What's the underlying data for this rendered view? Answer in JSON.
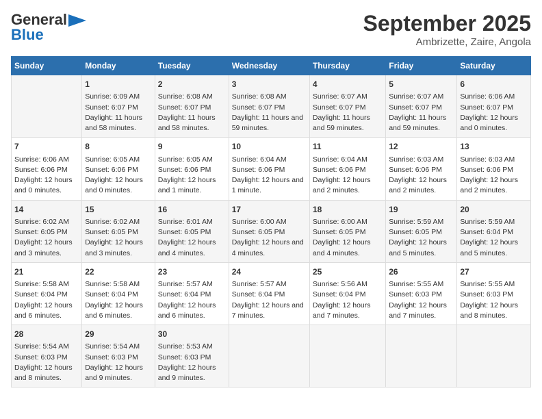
{
  "logo": {
    "general": "General",
    "blue": "Blue"
  },
  "title": "September 2025",
  "subtitle": "Ambrizette, Zaire, Angola",
  "days": [
    "Sunday",
    "Monday",
    "Tuesday",
    "Wednesday",
    "Thursday",
    "Friday",
    "Saturday"
  ],
  "weeks": [
    [
      {
        "day": "",
        "sunrise": "",
        "sunset": "",
        "daylight": ""
      },
      {
        "day": "1",
        "sunrise": "Sunrise: 6:09 AM",
        "sunset": "Sunset: 6:07 PM",
        "daylight": "Daylight: 11 hours and 58 minutes."
      },
      {
        "day": "2",
        "sunrise": "Sunrise: 6:08 AM",
        "sunset": "Sunset: 6:07 PM",
        "daylight": "Daylight: 11 hours and 58 minutes."
      },
      {
        "day": "3",
        "sunrise": "Sunrise: 6:08 AM",
        "sunset": "Sunset: 6:07 PM",
        "daylight": "Daylight: 11 hours and 59 minutes."
      },
      {
        "day": "4",
        "sunrise": "Sunrise: 6:07 AM",
        "sunset": "Sunset: 6:07 PM",
        "daylight": "Daylight: 11 hours and 59 minutes."
      },
      {
        "day": "5",
        "sunrise": "Sunrise: 6:07 AM",
        "sunset": "Sunset: 6:07 PM",
        "daylight": "Daylight: 11 hours and 59 minutes."
      },
      {
        "day": "6",
        "sunrise": "Sunrise: 6:06 AM",
        "sunset": "Sunset: 6:07 PM",
        "daylight": "Daylight: 12 hours and 0 minutes."
      }
    ],
    [
      {
        "day": "7",
        "sunrise": "Sunrise: 6:06 AM",
        "sunset": "Sunset: 6:06 PM",
        "daylight": "Daylight: 12 hours and 0 minutes."
      },
      {
        "day": "8",
        "sunrise": "Sunrise: 6:05 AM",
        "sunset": "Sunset: 6:06 PM",
        "daylight": "Daylight: 12 hours and 0 minutes."
      },
      {
        "day": "9",
        "sunrise": "Sunrise: 6:05 AM",
        "sunset": "Sunset: 6:06 PM",
        "daylight": "Daylight: 12 hours and 1 minute."
      },
      {
        "day": "10",
        "sunrise": "Sunrise: 6:04 AM",
        "sunset": "Sunset: 6:06 PM",
        "daylight": "Daylight: 12 hours and 1 minute."
      },
      {
        "day": "11",
        "sunrise": "Sunrise: 6:04 AM",
        "sunset": "Sunset: 6:06 PM",
        "daylight": "Daylight: 12 hours and 2 minutes."
      },
      {
        "day": "12",
        "sunrise": "Sunrise: 6:03 AM",
        "sunset": "Sunset: 6:06 PM",
        "daylight": "Daylight: 12 hours and 2 minutes."
      },
      {
        "day": "13",
        "sunrise": "Sunrise: 6:03 AM",
        "sunset": "Sunset: 6:06 PM",
        "daylight": "Daylight: 12 hours and 2 minutes."
      }
    ],
    [
      {
        "day": "14",
        "sunrise": "Sunrise: 6:02 AM",
        "sunset": "Sunset: 6:05 PM",
        "daylight": "Daylight: 12 hours and 3 minutes."
      },
      {
        "day": "15",
        "sunrise": "Sunrise: 6:02 AM",
        "sunset": "Sunset: 6:05 PM",
        "daylight": "Daylight: 12 hours and 3 minutes."
      },
      {
        "day": "16",
        "sunrise": "Sunrise: 6:01 AM",
        "sunset": "Sunset: 6:05 PM",
        "daylight": "Daylight: 12 hours and 4 minutes."
      },
      {
        "day": "17",
        "sunrise": "Sunrise: 6:00 AM",
        "sunset": "Sunset: 6:05 PM",
        "daylight": "Daylight: 12 hours and 4 minutes."
      },
      {
        "day": "18",
        "sunrise": "Sunrise: 6:00 AM",
        "sunset": "Sunset: 6:05 PM",
        "daylight": "Daylight: 12 hours and 4 minutes."
      },
      {
        "day": "19",
        "sunrise": "Sunrise: 5:59 AM",
        "sunset": "Sunset: 6:05 PM",
        "daylight": "Daylight: 12 hours and 5 minutes."
      },
      {
        "day": "20",
        "sunrise": "Sunrise: 5:59 AM",
        "sunset": "Sunset: 6:04 PM",
        "daylight": "Daylight: 12 hours and 5 minutes."
      }
    ],
    [
      {
        "day": "21",
        "sunrise": "Sunrise: 5:58 AM",
        "sunset": "Sunset: 6:04 PM",
        "daylight": "Daylight: 12 hours and 6 minutes."
      },
      {
        "day": "22",
        "sunrise": "Sunrise: 5:58 AM",
        "sunset": "Sunset: 6:04 PM",
        "daylight": "Daylight: 12 hours and 6 minutes."
      },
      {
        "day": "23",
        "sunrise": "Sunrise: 5:57 AM",
        "sunset": "Sunset: 6:04 PM",
        "daylight": "Daylight: 12 hours and 6 minutes."
      },
      {
        "day": "24",
        "sunrise": "Sunrise: 5:57 AM",
        "sunset": "Sunset: 6:04 PM",
        "daylight": "Daylight: 12 hours and 7 minutes."
      },
      {
        "day": "25",
        "sunrise": "Sunrise: 5:56 AM",
        "sunset": "Sunset: 6:04 PM",
        "daylight": "Daylight: 12 hours and 7 minutes."
      },
      {
        "day": "26",
        "sunrise": "Sunrise: 5:55 AM",
        "sunset": "Sunset: 6:03 PM",
        "daylight": "Daylight: 12 hours and 7 minutes."
      },
      {
        "day": "27",
        "sunrise": "Sunrise: 5:55 AM",
        "sunset": "Sunset: 6:03 PM",
        "daylight": "Daylight: 12 hours and 8 minutes."
      }
    ],
    [
      {
        "day": "28",
        "sunrise": "Sunrise: 5:54 AM",
        "sunset": "Sunset: 6:03 PM",
        "daylight": "Daylight: 12 hours and 8 minutes."
      },
      {
        "day": "29",
        "sunrise": "Sunrise: 5:54 AM",
        "sunset": "Sunset: 6:03 PM",
        "daylight": "Daylight: 12 hours and 9 minutes."
      },
      {
        "day": "30",
        "sunrise": "Sunrise: 5:53 AM",
        "sunset": "Sunset: 6:03 PM",
        "daylight": "Daylight: 12 hours and 9 minutes."
      },
      {
        "day": "",
        "sunrise": "",
        "sunset": "",
        "daylight": ""
      },
      {
        "day": "",
        "sunrise": "",
        "sunset": "",
        "daylight": ""
      },
      {
        "day": "",
        "sunrise": "",
        "sunset": "",
        "daylight": ""
      },
      {
        "day": "",
        "sunrise": "",
        "sunset": "",
        "daylight": ""
      }
    ]
  ]
}
